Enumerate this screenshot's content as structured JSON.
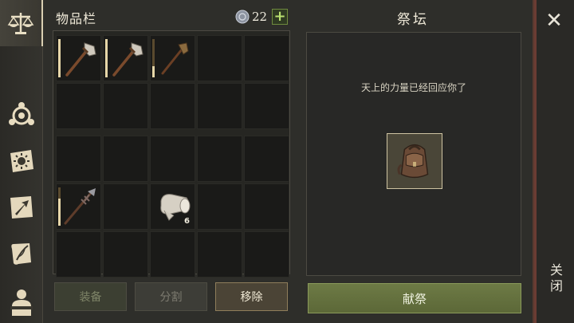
{
  "sidebar": {
    "tabs": [
      {
        "icon": "scales-icon",
        "active": true
      },
      {
        "icon": "triskelion-icon",
        "active": false
      },
      {
        "icon": "sun-book-icon",
        "active": false
      },
      {
        "icon": "crafting-arrow-icon",
        "active": false
      },
      {
        "icon": "scroll-quill-icon",
        "active": false
      },
      {
        "icon": "character-silhouette-icon",
        "active": false
      }
    ]
  },
  "inventory": {
    "title": "物品栏",
    "coins": "22",
    "add_label": "+",
    "slots": [
      {
        "grid": 1,
        "index": 0,
        "item": "stone-axe",
        "durability": 1.0
      },
      {
        "grid": 1,
        "index": 1,
        "item": "stone-axe",
        "durability": 1.0
      },
      {
        "grid": 1,
        "index": 2,
        "item": "torch",
        "durability": 0.3
      },
      {
        "grid": 2,
        "index": 5,
        "item": "spiked-spear",
        "durability": 0.7
      },
      {
        "grid": 2,
        "index": 7,
        "item": "cloth-roll",
        "quantity": "6"
      }
    ]
  },
  "buttons": {
    "equip": "装备",
    "split": "分割",
    "remove": "移除"
  },
  "altar": {
    "title": "祭坛",
    "message": "天上的力量已经回应你了",
    "reward_icon": "leather-backpack-icon",
    "offer_label": "献祭"
  },
  "close": {
    "icon": "close-icon",
    "label": "关闭"
  }
}
